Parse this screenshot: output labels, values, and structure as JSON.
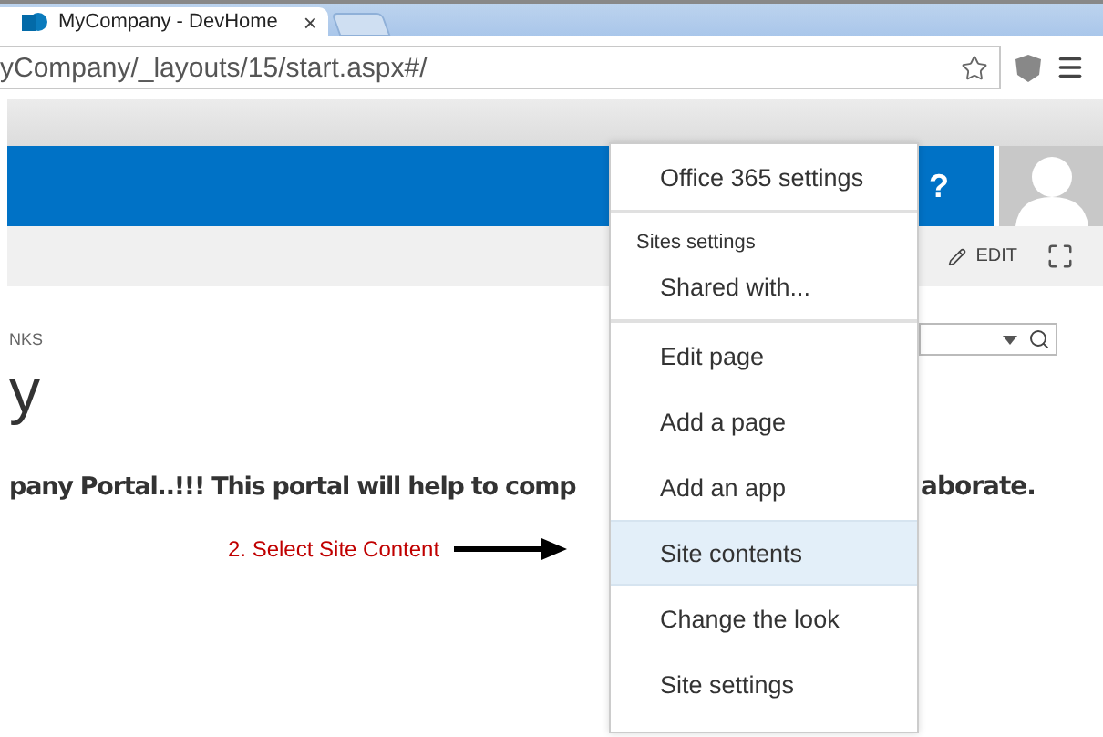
{
  "browser": {
    "tab_title": "MyCompany - DevHome",
    "tab_close": "×",
    "address": "yCompany/_layouts/15/start.aspx#/"
  },
  "suite_bar": {
    "help": "?"
  },
  "ribbon": {
    "edit": "EDIT"
  },
  "breadcrumb": "NKS",
  "page_title": "y",
  "welcome": {
    "left": "pany Portal..!!!  This portal will help to comp",
    "right": "aborate."
  },
  "annotation": "2. Select Site Content",
  "menu": {
    "items": [
      {
        "kind": "item",
        "label": "Office 365 settings",
        "selected": false
      },
      {
        "kind": "separator"
      },
      {
        "kind": "heading",
        "label": "Sites settings"
      },
      {
        "kind": "item",
        "label": "Shared with...",
        "selected": false
      },
      {
        "kind": "separator"
      },
      {
        "kind": "item",
        "label": "Edit page",
        "selected": false
      },
      {
        "kind": "item",
        "label": "Add a page",
        "selected": false
      },
      {
        "kind": "item",
        "label": "Add an app",
        "selected": false
      },
      {
        "kind": "item",
        "label": "Site contents",
        "selected": true
      },
      {
        "kind": "item",
        "label": "Change the look",
        "selected": false
      },
      {
        "kind": "item",
        "label": "Site settings",
        "selected": false
      }
    ]
  }
}
